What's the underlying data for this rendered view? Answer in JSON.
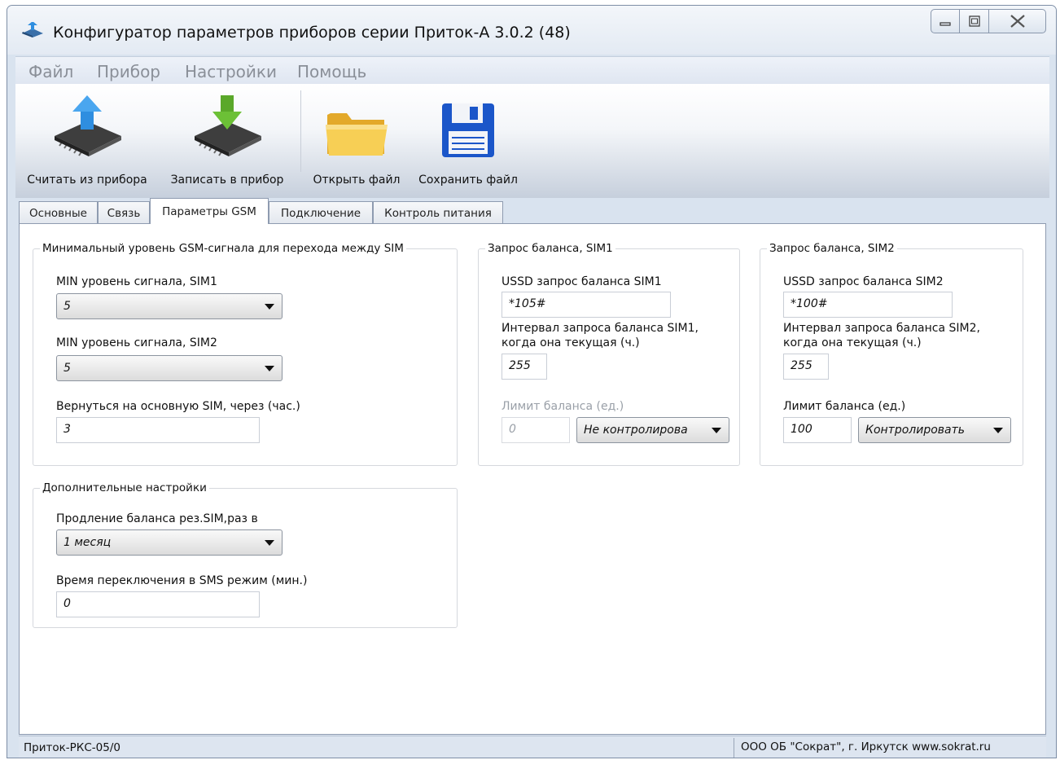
{
  "window": {
    "title": "Конфигуратор параметров приборов серии Приток-А   3.0.2 (48)"
  },
  "menu": [
    "Файл",
    "Прибор",
    "Настройки",
    "Помощь"
  ],
  "toolbar": {
    "read": "Считать из прибора",
    "write": "Записать в прибор",
    "open": "Открыть файл",
    "save": "Сохранить файл"
  },
  "tabs": [
    "Основные",
    "Связь",
    "Параметры GSM",
    "Подключение",
    "Контроль питания"
  ],
  "active_tab": "Параметры GSM",
  "gsm_signal": {
    "title": "Минимальный уровень GSM-сигнала для перехода между SIM",
    "sim1_label": "MIN уровень сигнала, SIM1",
    "sim1_value": "5",
    "sim2_label": "MIN уровень сигнала, SIM2",
    "sim2_value": "5",
    "return_label": "Вернуться на основную SIM, через (час.)",
    "return_value": "3"
  },
  "sim1_balance": {
    "title": "Запрос баланса, SIM1",
    "ussd_label": "USSD запрос баланса SIM1",
    "ussd_value": "*105#",
    "interval_label_1": "Интервал запроса баланса SIM1,",
    "interval_label_2": "когда она текущая (ч.)",
    "interval_value": "255",
    "limit_label": "Лимит баланса (ед.)",
    "limit_value": "0",
    "control_value": "Не контролирова"
  },
  "sim2_balance": {
    "title": "Запрос баланса, SIM2",
    "ussd_label": "USSD запрос баланса SIM2",
    "ussd_value": "*100#",
    "interval_label_1": "Интервал запроса баланса SIM2,",
    "interval_label_2": "когда она текущая (ч.)",
    "interval_value": "255",
    "limit_label": "Лимит баланса (ед.)",
    "limit_value": "100",
    "control_value": "Контролировать"
  },
  "extra": {
    "title": "Дополнительные настройки",
    "extend_label": "Продление баланса рез.SIM,раз в",
    "extend_value": "1 месяц",
    "sms_label": "Время переключения в SMS режим (мин.)",
    "sms_value": "0"
  },
  "status": {
    "device": "Приток-РКС-05/0",
    "company": "ООО ОБ \"Сократ\", г. Иркутск   www.sokrat.ru"
  },
  "colors": {
    "frame": "#d9e3ef",
    "menu_text": "#8a8f98",
    "arrow_blue": "#2f8ee0",
    "arrow_green": "#5aa82a",
    "folder_yellow": "#f5c84a",
    "floppy_blue": "#1b56c9"
  }
}
